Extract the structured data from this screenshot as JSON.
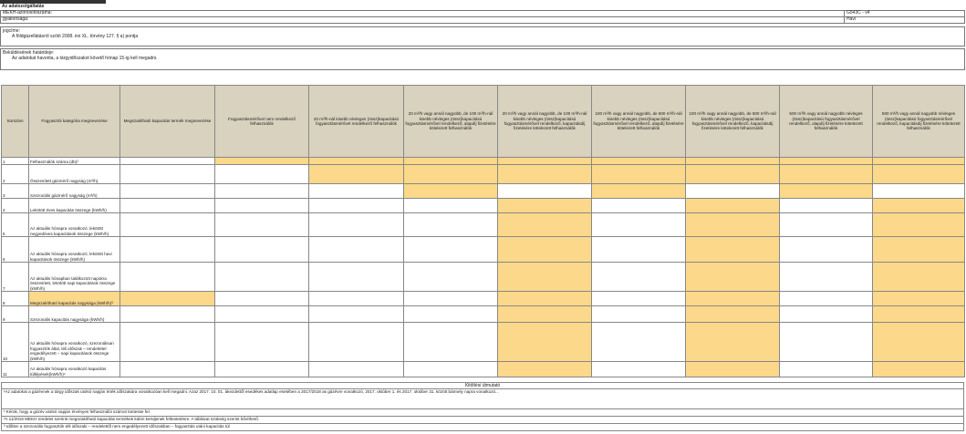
{
  "header": {
    "tab_label": "",
    "title": "Az adatszolgáltatás",
    "rows": [
      {
        "label": "MEKH-azonosítószáma:",
        "value": "G543C - v4"
      },
      {
        "label": "gyakorisága:",
        "value": "Havi"
      }
    ]
  },
  "legal": {
    "label": "jogcíme:",
    "text": "A földgázellátásról szóló 2008. évi XL. törvény 127. § a) pontja"
  },
  "deadline": {
    "label": "Beküldésének határideje:",
    "text": "Az adatokat havonta, a tárgyidőszakot követő hónap 15-ig kell megadni."
  },
  "table": {
    "headers": [
      "Sorszám",
      "Fogyasztói kategória megnevezése",
      "Megszakítható kapacitás termék megnevezése",
      "Fogyasztásmérővel nem rendelkező felhasználók",
      "20 m³/h-nál kisebb névleges (össz)kapacitású fogyasztásmérővel rendelkező felhasználók",
      "20 m³/h vagy annál nagyobb, de 100 m³/h-nál kisebb névleges (össz)kapacitású fogyasztásmérővel rendelkező, alapdíj fizetésére kötelezett felhasználók",
      "20 m³/h vagy annál nagyobb, de 100 m³/h-nál kisebb névleges (össz)kapacitású fogyasztásmérővel rendelkező, kapacitásdíj fizetésére kötelezett felhasználók",
      "100 m³/h vagy annál nagyobb, de 500 m³/h-nál kisebb névleges (össz)kapacitású fogyasztásmérővel rendelkező, alapdíj fizetésére kötelezett felhasználók",
      "100 m³/h vagy annál nagyobb, de 500 m³/h-nál kisebb névleges (össz)kapacitású fogyasztásmérővel rendelkező, kapacitásdíj fizetésére kötelezett felhasználók",
      "500 m³/h vagy annál nagyobb névleges (össz)kapacitású fogyasztásmérővel rendelkező, alapdíj fizetésére kötelezett felhasználók",
      "500 m³/h vagy annál nagyobb névleges (össz)kapacitású fogyasztásmérővel rendelkező, kapacitásdíj fizetésére kötelezett felhasználók"
    ],
    "rows": [
      {
        "num": "1",
        "label": "Felhasználók száma (db)²"
      },
      {
        "num": "2",
        "label": "Összesített gázmérő nagyság (m³/h)"
      },
      {
        "num": "3",
        "label": "Szezonális gázmérő nagyság (m³/h)"
      },
      {
        "num": "4",
        "label": "Lekötött éves kapacitás összege (kWh/h)"
      },
      {
        "num": "5",
        "label": "Az aktuális hónapra vonatkozó, lekötött negyedéves kapacitások összege (kWh/h)"
      },
      {
        "num": "6",
        "label": "Az aktuális hónapra vonatkozó, lekötött havi kapacitások összege (kWh/h)"
      },
      {
        "num": "7",
        "label": "Az aktuális hónapban találkozott napokra összesített, lekötött napi kapacitások összege (kWh/h)"
      },
      {
        "num": "8",
        "label": "Megszakítható kapacitás nagysága (kWh/h)³"
      },
      {
        "num": "9",
        "label": "Szezonális kapacitás nagysága (kWh/h)"
      },
      {
        "num": "10",
        "label": "Az aktuális hónapra vonatkozó, szezonálisan fogyasztók által, téli időszak – rendelettel engedélyezett – napi kapacitások összege (kWh/h)"
      },
      {
        "num": "11",
        "label": "Az aktuális hónapra vonatkozó kapacitás túllépések(kWh/h)⁴"
      }
    ]
  },
  "guide": {
    "title": "Kitöltési útmutató",
    "notes": [
      "¹Az adatokat a gázévnek a tárgy időszak utolsó napján érték időszakára vonatkozóan kell megadni. Azaz 2017. 10. 01. ákezdettől esedékes adatlap esetében a 2017/2018 as gázévre vonatkozó, 2017. október 1. és 2017. október 31. között bármely napra vonatkozó...",
      "¹ Kérük, hogy a gázév utolsó napján érvényes felhasználói számot tüntesse fel.",
      "²A 11/2016 MEKH rendelet szerinti megszakítható kapacitás termékek külön kerüljenek feltüntetésre. A táblázat szükség szerint bővíthető.",
      "³ Időtlen a szezonális fogyasztók téli időszaki – rendelettől nem engedélyezett időszakban – fogyasztás utáni kapacitás túl"
    ]
  },
  "colors": {
    "header_bg": "#d8d2be",
    "input_yellow": "#fbd88a"
  }
}
